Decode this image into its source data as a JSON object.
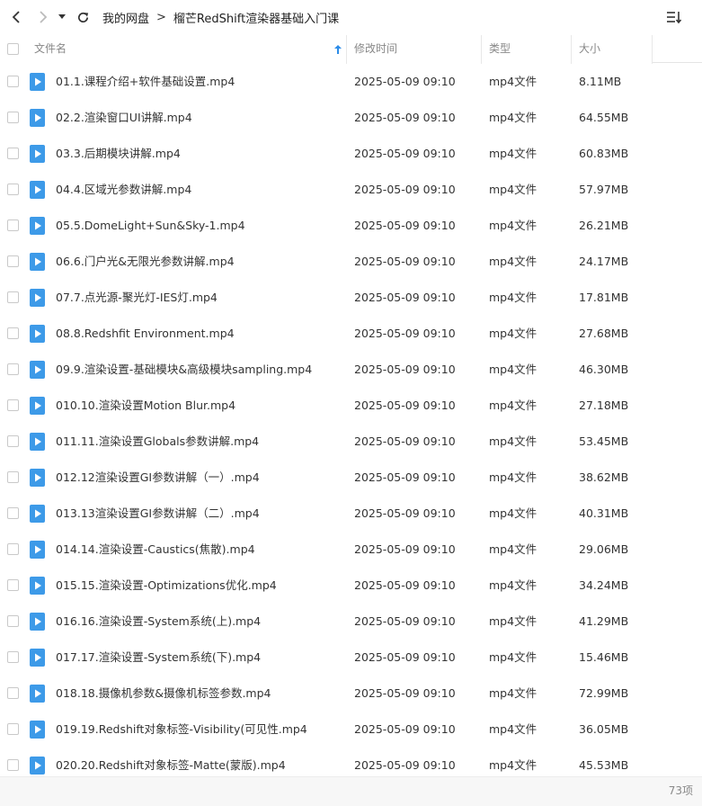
{
  "breadcrumb": {
    "items": [
      "我的网盘",
      "榴芒RedShift渲染器基础入门课"
    ],
    "separator": ">"
  },
  "icons": {
    "back": "chevron-left-icon",
    "forward": "chevron-right-icon",
    "history": "caret-down-icon",
    "refresh": "refresh-icon",
    "sort": "sort-list-icon",
    "file": "video-file-icon"
  },
  "colors": {
    "accent": "#2c8ce8",
    "file_icon": "#3d9ae8",
    "text": "#333333",
    "header_text": "#888888"
  },
  "columns": {
    "name": "文件名",
    "modified": "修改时间",
    "type": "类型",
    "size": "大小"
  },
  "files": [
    {
      "name": "01.1.课程介绍+软件基础设置.mp4",
      "date": "2025-05-09 09:10",
      "type": "mp4文件",
      "size": "8.11MB"
    },
    {
      "name": "02.2.渲染窗口UI讲解.mp4",
      "date": "2025-05-09 09:10",
      "type": "mp4文件",
      "size": "64.55MB"
    },
    {
      "name": "03.3.后期模块讲解.mp4",
      "date": "2025-05-09 09:10",
      "type": "mp4文件",
      "size": "60.83MB"
    },
    {
      "name": "04.4.区域光参数讲解.mp4",
      "date": "2025-05-09 09:10",
      "type": "mp4文件",
      "size": "57.97MB"
    },
    {
      "name": "05.5.DomeLight+Sun&Sky-1.mp4",
      "date": "2025-05-09 09:10",
      "type": "mp4文件",
      "size": "26.21MB"
    },
    {
      "name": "06.6.门户光&无限光参数讲解.mp4",
      "date": "2025-05-09 09:10",
      "type": "mp4文件",
      "size": "24.17MB"
    },
    {
      "name": "07.7.点光源-聚光灯-IES灯.mp4",
      "date": "2025-05-09 09:10",
      "type": "mp4文件",
      "size": "17.81MB"
    },
    {
      "name": "08.8.Redshfit Environment.mp4",
      "date": "2025-05-09 09:10",
      "type": "mp4文件",
      "size": "27.68MB"
    },
    {
      "name": "09.9.渲染设置-基础模块&高级模块sampling.mp4",
      "date": "2025-05-09 09:10",
      "type": "mp4文件",
      "size": "46.30MB"
    },
    {
      "name": "010.10.渲染设置Motion Blur.mp4",
      "date": "2025-05-09 09:10",
      "type": "mp4文件",
      "size": "27.18MB"
    },
    {
      "name": "011.11.渲染设置Globals参数讲解.mp4",
      "date": "2025-05-09 09:10",
      "type": "mp4文件",
      "size": "53.45MB"
    },
    {
      "name": "012.12渲染设置GI参数讲解（一）.mp4",
      "date": "2025-05-09 09:10",
      "type": "mp4文件",
      "size": "38.62MB"
    },
    {
      "name": "013.13渲染设置GI参数讲解（二）.mp4",
      "date": "2025-05-09 09:10",
      "type": "mp4文件",
      "size": "40.31MB"
    },
    {
      "name": "014.14.渲染设置-Caustics(焦散).mp4",
      "date": "2025-05-09 09:10",
      "type": "mp4文件",
      "size": "29.06MB"
    },
    {
      "name": "015.15.渲染设置-Optimizations优化.mp4",
      "date": "2025-05-09 09:10",
      "type": "mp4文件",
      "size": "34.24MB"
    },
    {
      "name": "016.16.渲染设置-System系统(上).mp4",
      "date": "2025-05-09 09:10",
      "type": "mp4文件",
      "size": "41.29MB"
    },
    {
      "name": "017.17.渲染设置-System系统(下).mp4",
      "date": "2025-05-09 09:10",
      "type": "mp4文件",
      "size": "15.46MB"
    },
    {
      "name": "018.18.摄像机参数&摄像机标签参数.mp4",
      "date": "2025-05-09 09:10",
      "type": "mp4文件",
      "size": "72.99MB"
    },
    {
      "name": "019.19.Redshift对象标签-Visibility(可见性.mp4",
      "date": "2025-05-09 09:10",
      "type": "mp4文件",
      "size": "36.05MB"
    },
    {
      "name": "020.20.Redshift对象标签-Matte(蒙版).mp4",
      "date": "2025-05-09 09:10",
      "type": "mp4文件",
      "size": "45.53MB"
    }
  ],
  "status": {
    "count": "73项"
  }
}
